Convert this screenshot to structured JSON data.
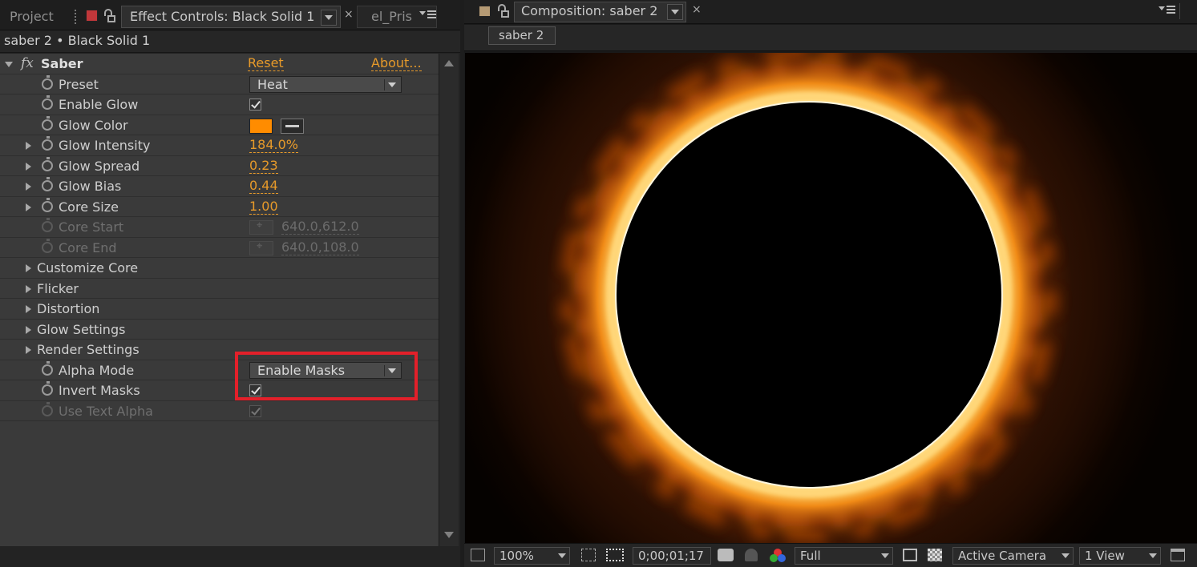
{
  "left_tabs": {
    "project": "Project",
    "effect_controls": "Effect Controls: Black Solid 1",
    "third": "el_Pris"
  },
  "breadcrumb": "saber 2 • Black Solid 1",
  "effect": {
    "name": "Saber",
    "reset": "Reset",
    "about": "About..."
  },
  "params": {
    "preset": {
      "label": "Preset",
      "value": "Heat"
    },
    "enable_glow": {
      "label": "Enable Glow",
      "checked": true
    },
    "glow_color": {
      "label": "Glow Color",
      "color": "#ff8c00"
    },
    "glow_intensity": {
      "label": "Glow Intensity",
      "value": "184.0%"
    },
    "glow_spread": {
      "label": "Glow Spread",
      "value": "0.23"
    },
    "glow_bias": {
      "label": "Glow Bias",
      "value": "0.44"
    },
    "core_size": {
      "label": "Core Size",
      "value": "1.00"
    },
    "core_start": {
      "label": "Core Start",
      "value": "640.0,612.0"
    },
    "core_end": {
      "label": "Core End",
      "value": "640.0,108.0"
    },
    "customize_core": {
      "label": "Customize Core"
    },
    "flicker": {
      "label": "Flicker"
    },
    "distortion": {
      "label": "Distortion"
    },
    "glow_settings": {
      "label": "Glow Settings"
    },
    "render_settings": {
      "label": "Render Settings"
    },
    "alpha_mode": {
      "label": "Alpha Mode",
      "value": "Enable Masks"
    },
    "invert_masks": {
      "label": "Invert Masks",
      "checked": true
    },
    "use_text_alpha": {
      "label": "Use Text Alpha",
      "checked": true
    }
  },
  "composition": {
    "tab": "Composition: saber 2",
    "chip": "saber 2"
  },
  "viewer_bar": {
    "zoom": "100%",
    "timecode": "0;00;01;17",
    "resolution": "Full",
    "camera": "Active Camera",
    "views": "1 View"
  },
  "colors": {
    "accent": "#e79a2a",
    "highlight_box": "#e3202a",
    "glow": "#ff8c00"
  }
}
